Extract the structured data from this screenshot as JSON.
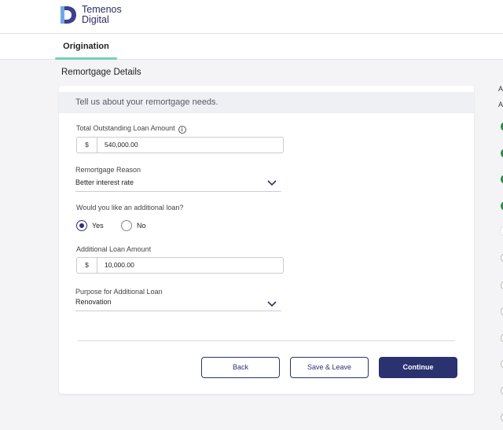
{
  "brand": {
    "name_line1": "Temenos",
    "name_line2": "Digital"
  },
  "tabs": [
    {
      "label": "Origination",
      "active": true
    }
  ],
  "page": {
    "title": "Remortgage Details"
  },
  "card": {
    "header": "Tell us about your remortgage needs."
  },
  "form": {
    "outstanding_loan": {
      "label": "Total Outstanding Loan Amount",
      "currency": "$",
      "value": "540,000.00"
    },
    "remortgage_reason": {
      "label": "Remortgage Reason",
      "value": "Better interest rate"
    },
    "additional_loan_question": {
      "label": "Would you like an additional loan?",
      "options": [
        "Yes",
        "No"
      ],
      "selected": "Yes"
    },
    "additional_loan_amount": {
      "label": "Additional Loan Amount",
      "currency": "$",
      "value": "10,000.00"
    },
    "purpose": {
      "label": "Purpose for Additional Loan",
      "value": "Renovation"
    }
  },
  "actions": {
    "back": "Back",
    "save_leave": "Save & Leave",
    "continue": "Continue"
  },
  "sidebar": {
    "letter1": "A",
    "letter2": "A"
  },
  "colors": {
    "primary": "#2b3270",
    "accent_tab": "#6fd3b5",
    "step_done": "#2e8b4d"
  }
}
